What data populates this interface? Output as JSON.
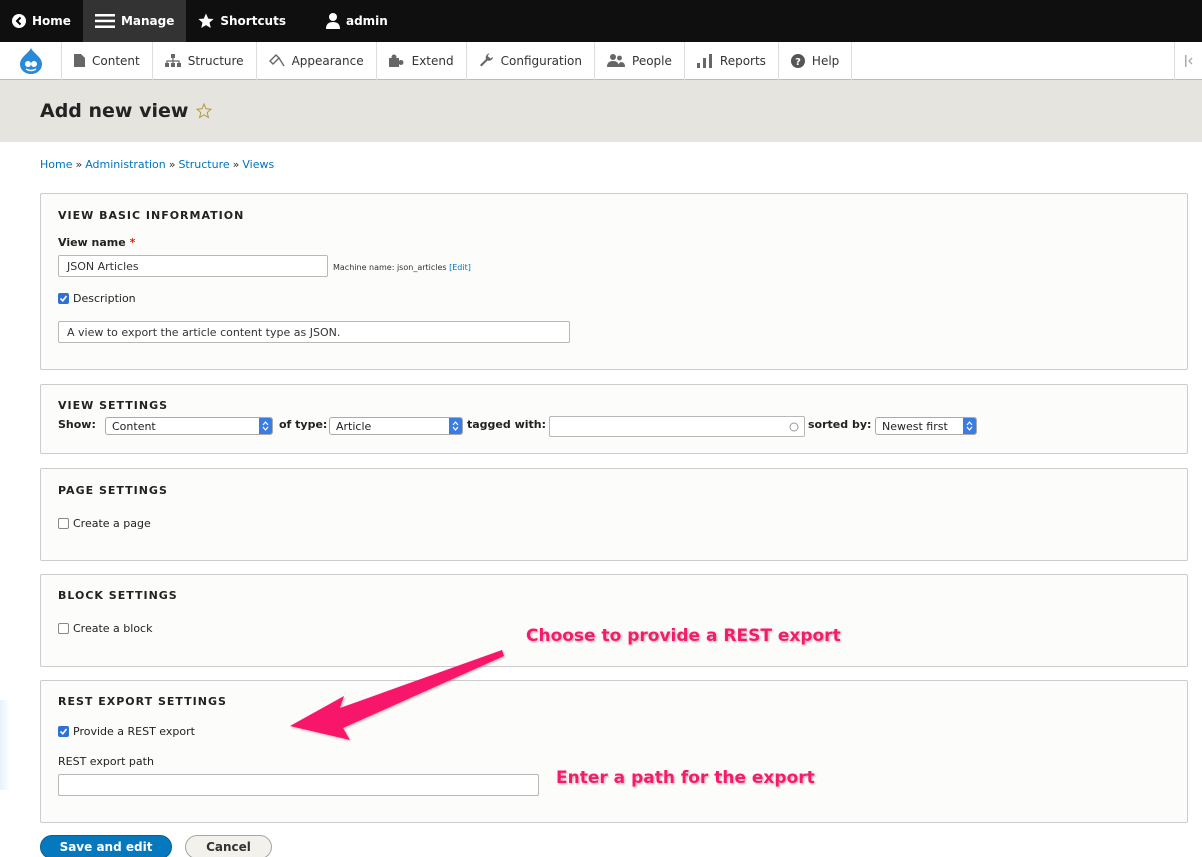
{
  "toolbar": {
    "home": "Home",
    "manage": "Manage",
    "shortcuts": "Shortcuts",
    "user": "admin"
  },
  "tray": {
    "items": [
      "Content",
      "Structure",
      "Appearance",
      "Extend",
      "Configuration",
      "People",
      "Reports",
      "Help"
    ]
  },
  "page": {
    "title": "Add new view",
    "breadcrumb": [
      "Home",
      "Administration",
      "Structure",
      "Views"
    ],
    "breadcrumb_sep": "»"
  },
  "basic": {
    "legend": "VIEW BASIC INFORMATION",
    "name_label": "View name",
    "required_mark": "*",
    "name_value": "JSON Articles",
    "machine_label": "Machine name: json_articles",
    "machine_edit": "[Edit]",
    "description_label": "Description",
    "description_value": "A view to export the article content type as JSON."
  },
  "view_settings": {
    "legend": "VIEW SETTINGS",
    "show_label": "Show:",
    "show_value": "Content",
    "type_label": "of type:",
    "type_value": "Article",
    "tagged_label": "tagged with:",
    "tagged_value": "",
    "sorted_label": "sorted by:",
    "sorted_value": "Newest first"
  },
  "page_settings": {
    "legend": "PAGE SETTINGS",
    "create_label": "Create a page"
  },
  "block_settings": {
    "legend": "BLOCK SETTINGS",
    "create_label": "Create a block"
  },
  "rest_settings": {
    "legend": "REST EXPORT SETTINGS",
    "provide_label": "Provide a REST export",
    "path_label": "REST export path",
    "path_value": ""
  },
  "annotations": {
    "choose": "Choose to provide a REST export",
    "enter": "Enter a path for the export"
  },
  "buttons": {
    "save": "Save and edit",
    "cancel": "Cancel"
  },
  "colors": {
    "link": "#0074bd",
    "primary": "#0678be",
    "annotation": "#f7196b"
  }
}
